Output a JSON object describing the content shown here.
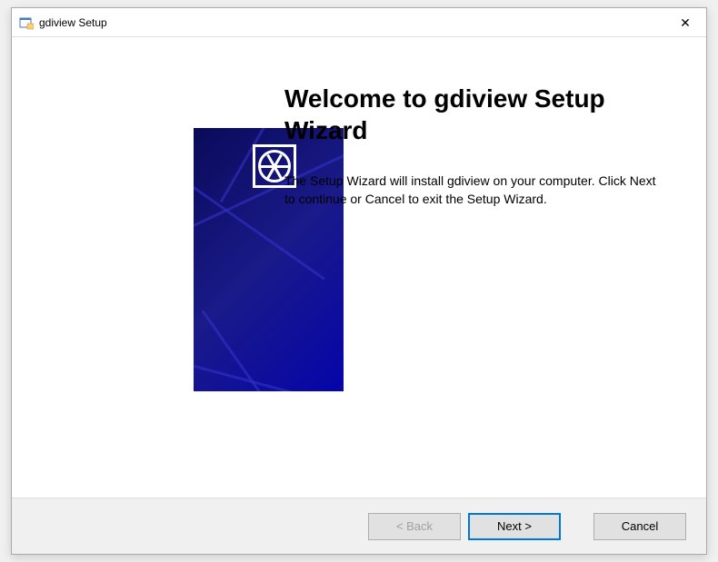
{
  "titlebar": {
    "title": "gdiview Setup"
  },
  "content": {
    "heading": "Welcome to gdiview Setup Wizard",
    "body": "The Setup Wizard will install gdiview on your computer.  Click Next to continue or Cancel to exit the Setup Wizard."
  },
  "buttons": {
    "back": "< Back",
    "next": "Next >",
    "cancel": "Cancel"
  }
}
